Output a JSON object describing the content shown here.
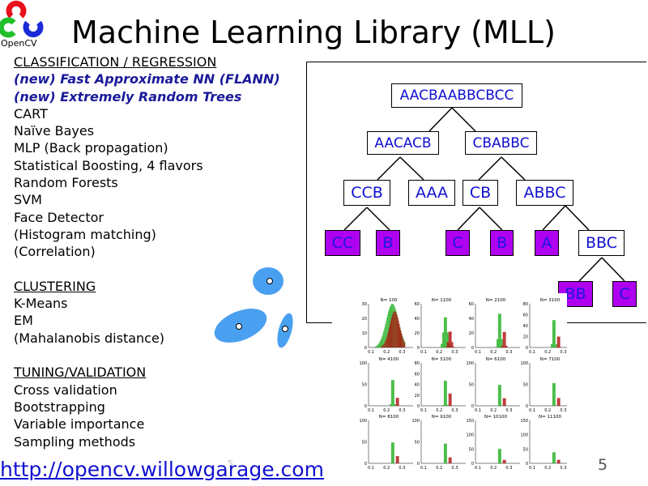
{
  "title": "Machine Learning Library (MLL)",
  "logo": {
    "text": "OpenCV",
    "colors": [
      "#e8101a",
      "#22c02a",
      "#1a2ad8"
    ]
  },
  "sections": [
    {
      "heading": "CLASSIFICATION / REGRESSION",
      "items": [
        {
          "text": "(new) Fast Approximate NN (FLANN)",
          "new": true
        },
        {
          "text": "(new) Extremely Random Trees",
          "new": true
        },
        {
          "text": "CART"
        },
        {
          "text": "Naïve Bayes"
        },
        {
          "text": "MLP (Back propagation)"
        },
        {
          "text": "Statistical Boosting, 4 flavors"
        },
        {
          "text": "Random Forests"
        },
        {
          "text": "SVM"
        },
        {
          "text": "Face Detector"
        },
        {
          "text": "(Histogram matching)"
        },
        {
          "text": "(Correlation)"
        }
      ]
    },
    {
      "heading": "CLUSTERING",
      "items": [
        {
          "text": "K-Means"
        },
        {
          "text": "EM"
        },
        {
          "text": "(Mahalanobis distance)"
        }
      ]
    },
    {
      "heading": "TUNING/VALIDATION",
      "items": [
        {
          "text": "Cross validation"
        },
        {
          "text": "Bootstrapping"
        },
        {
          "text": "Variable importance"
        },
        {
          "text": "Sampling methods"
        }
      ]
    }
  ],
  "tree": {
    "nodes": [
      "AACBAABBCBCC",
      "AACACB",
      "CBABBC",
      "CCB",
      "AAA",
      "CB",
      "ABBC",
      "CC",
      "B",
      "C",
      "B",
      "A",
      "BBC",
      "BB",
      "C"
    ],
    "leaf_color": "#b000f0",
    "text_color": "#1010d0"
  },
  "histograms": {
    "titles": [
      "N= 100",
      "N= 1100",
      "N= 2100",
      "N= 3100",
      "N= 4100",
      "N= 5100",
      "N= 6100",
      "N= 7100",
      "N= 8100",
      "N= 9100",
      "N= 10100",
      "N= 11100"
    ],
    "y_max": [
      30,
      60,
      60,
      80,
      100,
      80,
      100,
      100,
      100,
      100,
      150,
      150
    ],
    "x_ticks": [
      "0.1",
      "0.2",
      "0.3"
    ],
    "colors": {
      "green": "#22b022",
      "red": "#b01010"
    }
  },
  "footer": {
    "url": "http://opencv.willowgarage.com",
    "page": "5",
    "page_ghost": "5"
  }
}
